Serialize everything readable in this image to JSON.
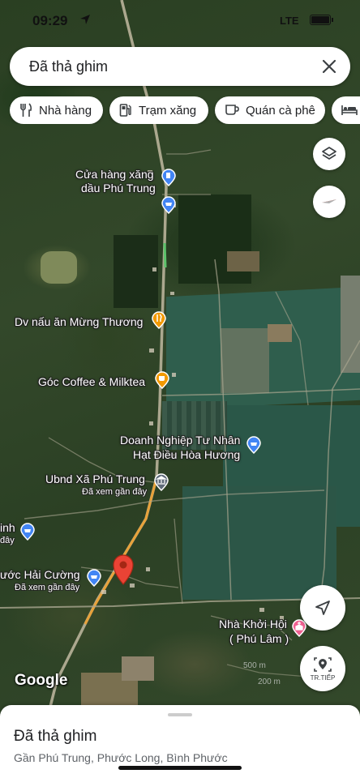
{
  "status": {
    "time": "09:29",
    "network": "LTE"
  },
  "search": {
    "text": "Đã thả ghim"
  },
  "chips": [
    {
      "label": "Nhà hàng",
      "icon": "restaurant-icon"
    },
    {
      "label": "Trạm xăng",
      "icon": "gas-station-icon"
    },
    {
      "label": "Quán cà phê",
      "icon": "coffee-icon"
    },
    {
      "label": "",
      "icon": "hotel-icon"
    }
  ],
  "places": {
    "gas": {
      "line1": "Cửa hàng xăng",
      "line2": "dầu Phú Trung"
    },
    "restaurant": {
      "label": "Dv nấu ăn Mừng Thương"
    },
    "cafe": {
      "label": "Góc Coffee & Milktea"
    },
    "enterprise": {
      "line1": "Doanh Nghiệp Tư Nhân",
      "line2": "Hạt Điều Hòa Hương"
    },
    "ubnd": {
      "label": "Ubnd Xã Phú Trung",
      "sub": "Đã xem gần đây"
    },
    "left_partial": {
      "line1": "inh",
      "line2": "đây"
    },
    "hai_cuong": {
      "label": "ước Hải Cường",
      "sub": "Đã xem gần đây"
    },
    "church": {
      "line1": "Nhà Khởi Hội",
      "line2": "( Phú Lâm )"
    }
  },
  "map": {
    "attribution": "Google",
    "scale_text": "500 m",
    "scale_text2": "200 m"
  },
  "buttons": {
    "street_view_label": "TR.TIẾP"
  },
  "sheet": {
    "title": "Đã thả ghim",
    "subtitle": "Gần Phú Trung, Phước Long, Bình Phước"
  },
  "colors": {
    "pin_red": "#ea4335",
    "place_blue": "#4285f4",
    "food_orange": "#f29900",
    "church_pink": "#f06292"
  }
}
